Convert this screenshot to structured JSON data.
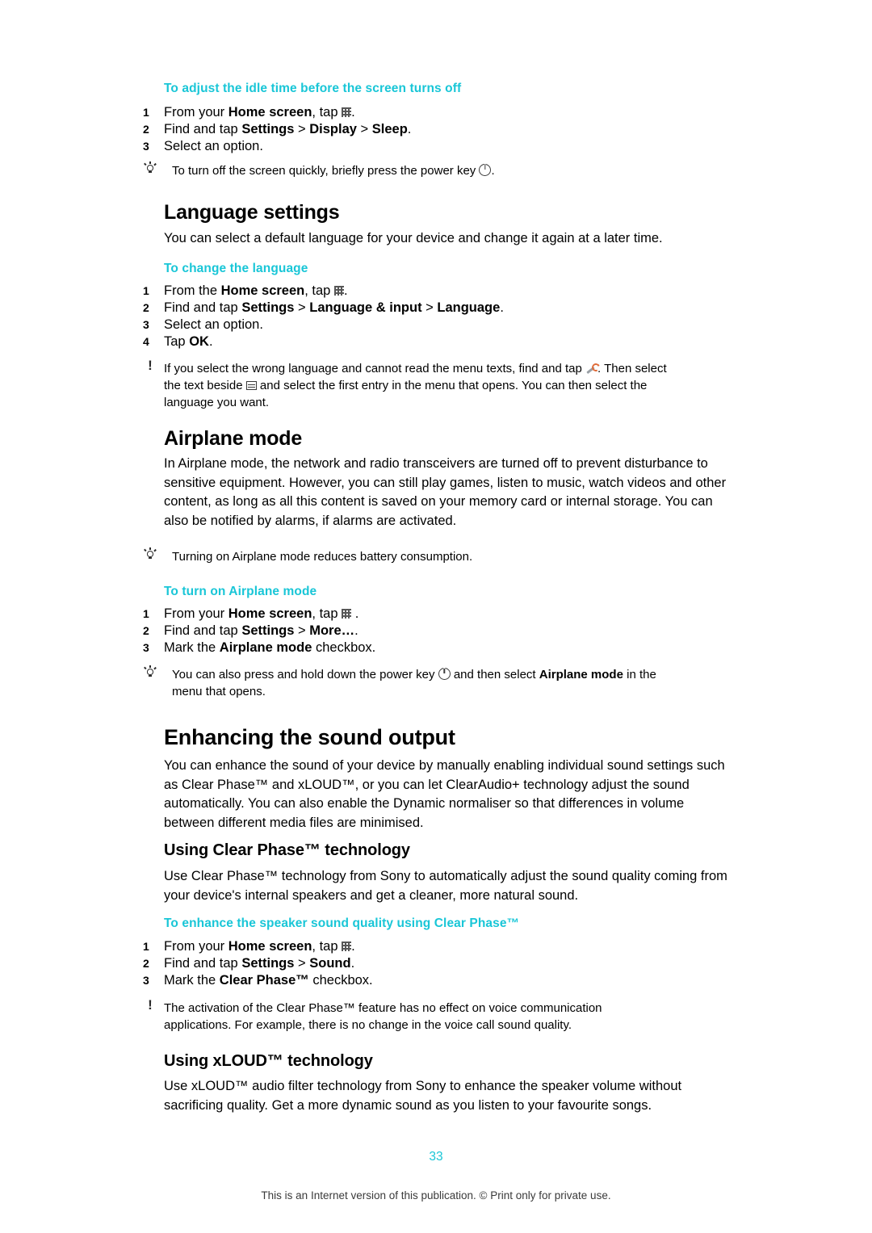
{
  "document": {
    "page_number": "33",
    "footer": "This is an Internet version of this publication. © Print only for private use."
  },
  "sections": [
    {
      "id": "idle-time",
      "heading": "To adjust the idle time before the screen turns off",
      "steps": [
        {
          "num": "1",
          "pre": "From your ",
          "bold1": "Home screen",
          "mid": ", tap ",
          "icon": "grid-icon",
          "post": "."
        },
        {
          "num": "2",
          "pre": "Find and tap ",
          "bold1": "Settings",
          "mid": " > ",
          "bold2": "Display",
          "mid2": " > ",
          "bold3": "Sleep",
          "post": "."
        },
        {
          "num": "3",
          "pre": "Select an option.",
          "post": ""
        }
      ],
      "tip": {
        "marker": "bulb-icon",
        "pre": "To turn off the screen quickly, briefly press the power key ",
        "icon": "power-icon",
        "post": "."
      }
    },
    {
      "id": "language-settings",
      "title": "Language settings",
      "intro": "You can select a default language for your device and change it again at a later time.",
      "heading": "To change the language",
      "steps": [
        {
          "num": "1",
          "pre": "From the ",
          "bold1": "Home screen",
          "mid": ", tap ",
          "icon": "grid-icon",
          "post": "."
        },
        {
          "num": "2",
          "pre": "Find and tap ",
          "bold1": "Settings",
          "mid": " > ",
          "bold2": "Language & input",
          "mid2": " > ",
          "bold3": "Language",
          "post": "."
        },
        {
          "num": "3",
          "pre": "Select an option.",
          "post": ""
        },
        {
          "num": "4",
          "pre": "Tap ",
          "bold1": "OK",
          "post": "."
        }
      ],
      "note": {
        "marker": "exclamation-icon",
        "line1_a": "If you select the wrong language and cannot read the menu texts, find and tap ",
        "line1_icon": "wrench-icon",
        "line1_b": ". Then select",
        "line2_a": "the text beside ",
        "line2_icon": "language-icon",
        "line2_b": " and select the first entry in the menu that opens. You can then select the",
        "line3": "language you want."
      }
    },
    {
      "id": "airplane-mode",
      "title": "Airplane mode",
      "paragraph": "In Airplane mode, the network and radio transceivers are turned off to prevent disturbance to sensitive equipment. However, you can still play games, listen to music, watch videos and other content, as long as all this content is saved on your memory card or internal storage. You can also be notified by alarms, if alarms are activated.",
      "tip1": {
        "marker": "bulb-icon",
        "text": "Turning on Airplane mode reduces battery consumption."
      },
      "heading": "To turn on Airplane mode",
      "steps": [
        {
          "num": "1",
          "pre": "From your ",
          "bold1": "Home screen",
          "mid": ", tap ",
          "icon": "grid-icon",
          "post": " ."
        },
        {
          "num": "2",
          "pre": "Find and tap ",
          "bold1": "Settings",
          "mid": " > ",
          "bold2": "More…",
          "post": "."
        },
        {
          "num": "3",
          "pre": "Mark the ",
          "bold1": "Airplane mode",
          "post": " checkbox."
        }
      ],
      "tip2": {
        "marker": "bulb-icon",
        "line1_a": "You can also press and hold down the power key ",
        "line1_icon": "power-icon",
        "line1_b": " and then select ",
        "line1_bold": "Airplane mode",
        "line1_c": " in the",
        "line2": "menu that opens."
      }
    },
    {
      "id": "enhancing-sound",
      "title": "Enhancing the sound output",
      "paragraph": "You can enhance the sound of your device by manually enabling individual sound settings such as Clear Phase™ and xLOUD™, or you can let ClearAudio+ technology adjust the sound automatically. You can also enable the Dynamic normaliser so that differences in volume between different media files are minimised.",
      "subsections": [
        {
          "title": "Using Clear Phase™ technology",
          "paragraph": "Use Clear Phase™ technology from Sony to automatically adjust the sound quality coming from your device's internal speakers and get a cleaner, more natural sound.",
          "heading": "To enhance the speaker sound quality using Clear Phase™",
          "steps": [
            {
              "num": "1",
              "pre": "From your ",
              "bold1": "Home screen",
              "mid": ", tap ",
              "icon": "grid-icon",
              "post": "."
            },
            {
              "num": "2",
              "pre": "Find and tap ",
              "bold1": "Settings",
              "mid": " > ",
              "bold2": "Sound",
              "post": "."
            },
            {
              "num": "3",
              "pre": "Mark the ",
              "bold1": "Clear Phase™",
              "post": " checkbox."
            }
          ],
          "note": {
            "marker": "exclamation-icon",
            "line1": "The activation of the Clear Phase™ feature has no effect on voice communication",
            "line2": "applications. For example, there is no change in the voice call sound quality."
          }
        },
        {
          "title": "Using xLOUD™ technology",
          "paragraph": "Use xLOUD™ audio filter technology from Sony to enhance the speaker volume without sacrificing quality. Get a more dynamic sound as you listen to your favourite songs."
        }
      ]
    }
  ],
  "colors": {
    "accent": "#19c6d7",
    "text": "#000000"
  }
}
